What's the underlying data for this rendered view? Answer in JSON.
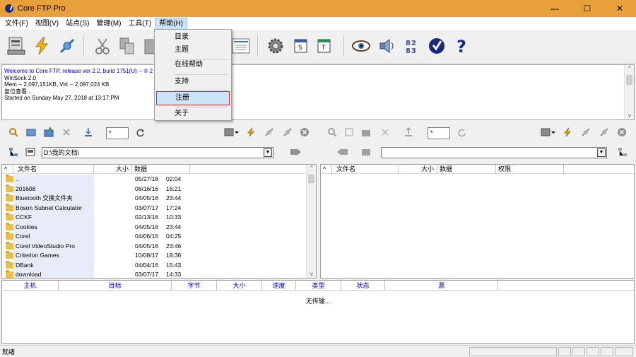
{
  "window": {
    "title": "Core FTP Pro",
    "minimize": "—",
    "maximize": "☐",
    "close": "✕"
  },
  "menubar": [
    {
      "label": "文件(F)"
    },
    {
      "label": "视图(V)"
    },
    {
      "label": "站点(S)"
    },
    {
      "label": "管理(M)"
    },
    {
      "label": "工具(T)"
    },
    {
      "label": "帮助(H)"
    }
  ],
  "help_menu": {
    "items": [
      "目录",
      "主题",
      "在线帮助",
      "支持",
      "注册",
      "关于"
    ],
    "highlighted": "注册"
  },
  "toolbar_icons": [
    "connect-icon",
    "quick-connect-icon",
    "disconnect-icon",
    "cut-icon",
    "copy-icon",
    "paste-icon",
    "view-icon",
    "settings-icon",
    "site-manager-icon",
    "transfer-icon",
    "view-eye-icon",
    "sound-icon",
    "sync-icon",
    "check-icon",
    "help-icon"
  ],
  "log": {
    "lines": [
      "Welcome to Core FTP, release ver 2.2, build 1751(U) -- ® 2",
      "WinSock 2.0",
      "Mem -- 2,097,151KB, Virt -- 2,097,024 KB",
      "复位查看...",
      "Started on Sunday May 27, 2018 at 13:17:PM"
    ]
  },
  "local": {
    "filter": "*",
    "path": "D:\\我的文档\\",
    "columns": [
      "^",
      "文件名",
      "大小",
      "数据"
    ],
    "rows": [
      {
        "name": "..",
        "date": "05/27/18",
        "time": "02:04"
      },
      {
        "name": "201608",
        "date": "08/16/16",
        "time": "16:21"
      },
      {
        "name": "Bluetooth 交换文件夹",
        "date": "04/05/16",
        "time": "23:44"
      },
      {
        "name": "Boson Subnet Calculator",
        "date": "03/07/17",
        "time": "17:24"
      },
      {
        "name": "CCKF",
        "date": "02/13/16",
        "time": "10:33"
      },
      {
        "name": "Cookies",
        "date": "04/05/16",
        "time": "23:44"
      },
      {
        "name": "Corel",
        "date": "04/06/16",
        "time": "04:25"
      },
      {
        "name": "Corel VideoStudio Pro",
        "date": "04/05/16",
        "time": "23:46"
      },
      {
        "name": "Criterion Games",
        "date": "10/08/17",
        "time": "18:36"
      },
      {
        "name": "DBank",
        "date": "04/04/16",
        "time": "15:43"
      },
      {
        "name": "download",
        "date": "03/07/17",
        "time": "14:33"
      }
    ]
  },
  "remote": {
    "filter": "*",
    "path": "",
    "columns": [
      "^",
      "文件名",
      "大小",
      "数据",
      "权限"
    ]
  },
  "queue": {
    "columns": [
      "主机",
      "目标",
      "字节",
      "大小",
      "速度",
      "类型",
      "状态",
      "源"
    ],
    "empty_text": "无传输..."
  },
  "status": {
    "text": "就绪"
  },
  "colors": {
    "titlebar": "#e8a03b",
    "queue_header": "#0000c8",
    "log_welcome": "#0000c8"
  }
}
